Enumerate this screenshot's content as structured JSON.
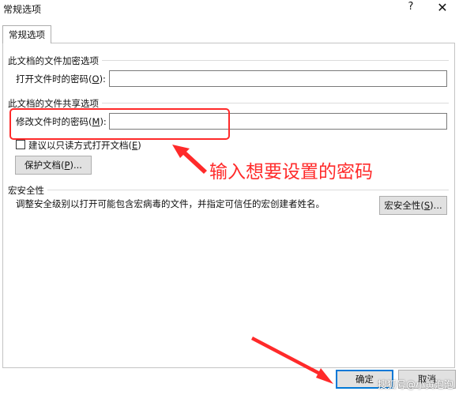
{
  "window": {
    "title": "常规选项",
    "help_glyph": "?",
    "close_glyph": "✕"
  },
  "tabs": [
    {
      "label": "常规选项"
    }
  ],
  "encryption": {
    "group_title": "此文档的文件加密选项",
    "open_password_label": "打开文件时的密码(",
    "open_password_key": "O",
    "open_password_suffix": "):",
    "open_password_value": ""
  },
  "sharing": {
    "group_title": "此文档的文件共享选项",
    "modify_password_label": "修改文件时的密码(",
    "modify_password_key": "M",
    "modify_password_suffix": "):",
    "modify_password_value": "",
    "readonly_checkbox_label": "建议以只读方式打开文档(",
    "readonly_checkbox_key": "E",
    "readonly_checkbox_suffix": ")",
    "readonly_checked": false,
    "protect_button_label": "保护文档(",
    "protect_button_key": "P",
    "protect_button_suffix": ")..."
  },
  "macro": {
    "group_title": "宏安全性",
    "description": "调整安全级别以打开可能包含宏病毒的文件，并指定可信任的宏创建者姓名。",
    "button_label": "宏安全性(",
    "button_key": "S",
    "button_suffix": ")..."
  },
  "footer": {
    "ok_label": "确定",
    "cancel_label": "取消"
  },
  "annotation": {
    "text": "输入想要设置的密码",
    "color": "#ff2a2a"
  },
  "watermark": {
    "text": "搜狐号@小黄泡泡"
  }
}
